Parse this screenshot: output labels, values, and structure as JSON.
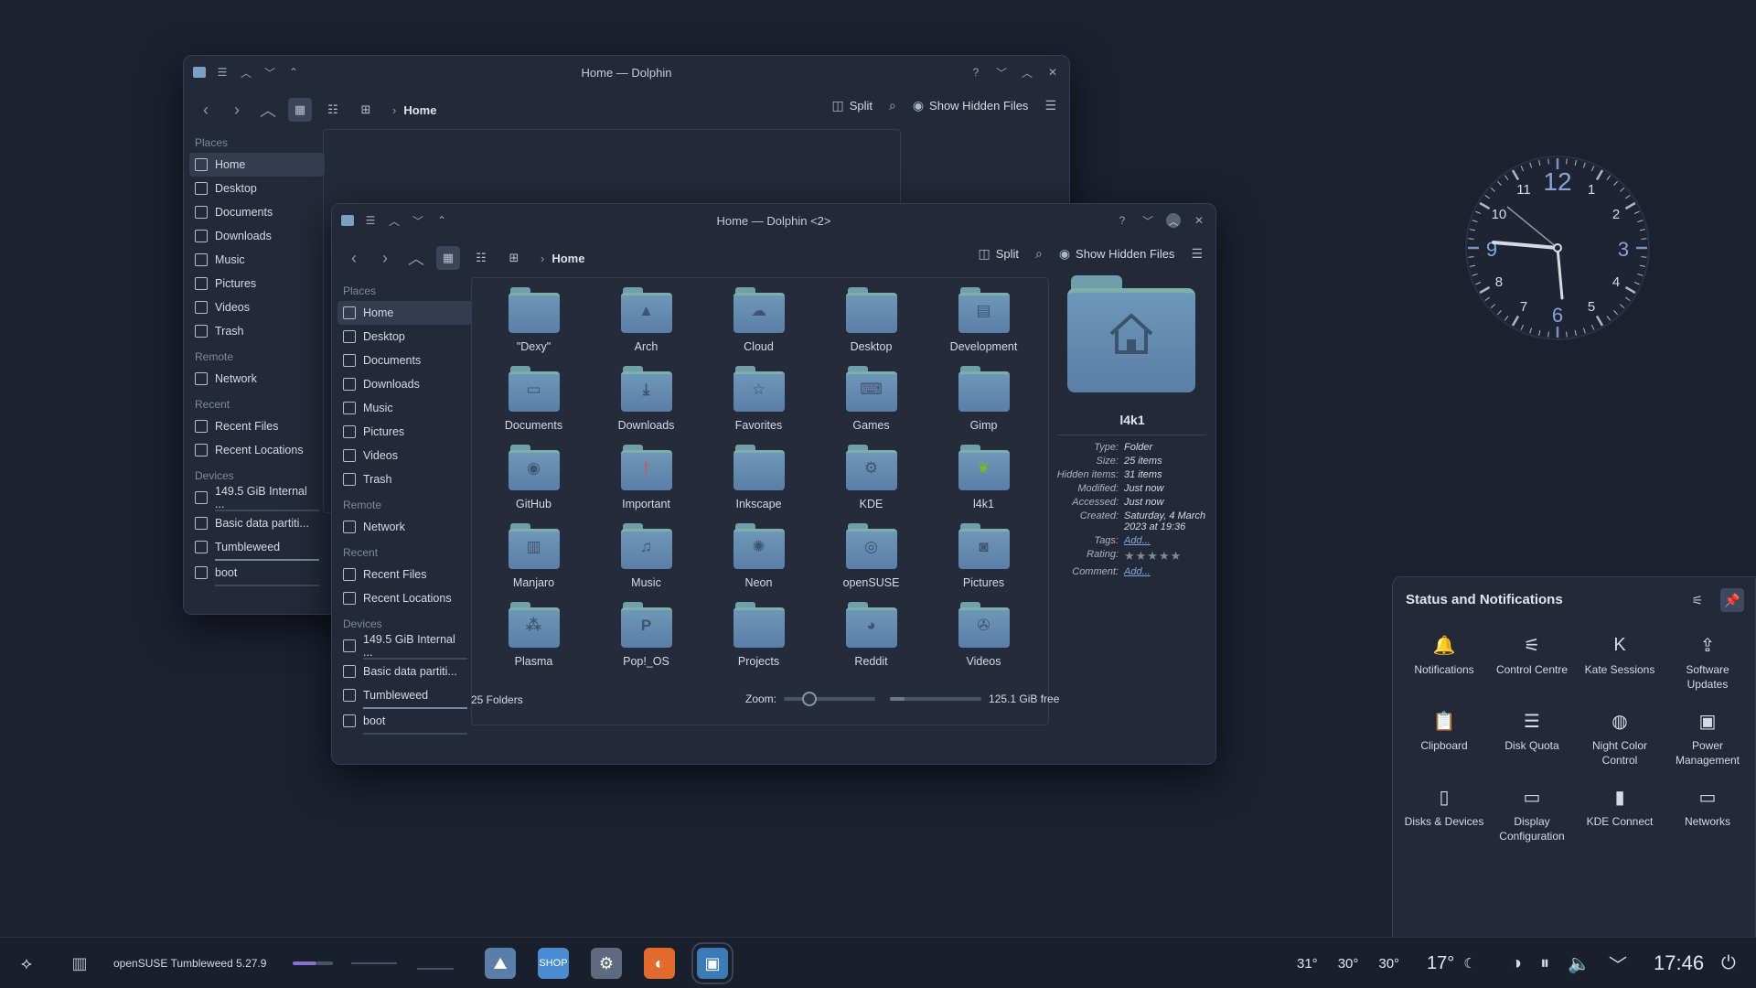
{
  "back_window": {
    "title": "Home — Dolphin",
    "breadcrumb": "Home",
    "toolbar": {
      "split": "Split",
      "show_hidden": "Show Hidden Files"
    },
    "sidebar": {
      "places_heading": "Places",
      "places": [
        "Home",
        "Desktop",
        "Documents",
        "Downloads",
        "Music",
        "Pictures",
        "Videos",
        "Trash"
      ],
      "remote_heading": "Remote",
      "remote": [
        "Network"
      ],
      "recent_heading": "Recent",
      "recent": [
        "Recent Files",
        "Recent Locations"
      ],
      "devices_heading": "Devices",
      "devices": [
        "149.5 GiB Internal ...",
        "Basic data partiti...",
        "Tumbleweed",
        "boot"
      ]
    }
  },
  "front_window": {
    "title": "Home — Dolphin <2>",
    "breadcrumb": "Home",
    "toolbar": {
      "split": "Split",
      "show_hidden": "Show Hidden Files"
    },
    "sidebar": {
      "places_heading": "Places",
      "places": [
        "Home",
        "Desktop",
        "Documents",
        "Downloads",
        "Music",
        "Pictures",
        "Videos",
        "Trash"
      ],
      "remote_heading": "Remote",
      "remote": [
        "Network"
      ],
      "recent_heading": "Recent",
      "recent": [
        "Recent Files",
        "Recent Locations"
      ],
      "devices_heading": "Devices",
      "devices": [
        "149.5 GiB Internal ...",
        "Basic data partiti...",
        "Tumbleweed",
        "boot"
      ]
    },
    "folders": [
      {
        "name": "\"Dexy\"",
        "icon": "blank-folder-icon"
      },
      {
        "name": "Arch",
        "icon": "arch-logo-icon"
      },
      {
        "name": "Cloud",
        "icon": "cloud-icon"
      },
      {
        "name": "Desktop",
        "icon": "desktop-icon"
      },
      {
        "name": "Development",
        "icon": "development-icon"
      },
      {
        "name": "Documents",
        "icon": "document-icon"
      },
      {
        "name": "Downloads",
        "icon": "download-icon"
      },
      {
        "name": "Favorites",
        "icon": "star-icon"
      },
      {
        "name": "Games",
        "icon": "gamepad-icon"
      },
      {
        "name": "Gimp",
        "icon": "blank-folder-icon"
      },
      {
        "name": "GitHub",
        "icon": "github-icon"
      },
      {
        "name": "Important",
        "icon": "exclamation-icon"
      },
      {
        "name": "Inkscape",
        "icon": "blank-folder-icon"
      },
      {
        "name": "KDE",
        "icon": "kde-logo-icon"
      },
      {
        "name": "l4k1",
        "icon": "chameleon-icon"
      },
      {
        "name": "Manjaro",
        "icon": "manjaro-logo-icon"
      },
      {
        "name": "Music",
        "icon": "music-note-icon"
      },
      {
        "name": "Neon",
        "icon": "neon-logo-icon"
      },
      {
        "name": "openSUSE",
        "icon": "opensuse-logo-icon"
      },
      {
        "name": "Pictures",
        "icon": "camera-icon"
      },
      {
        "name": "Plasma",
        "icon": "plasma-logo-icon"
      },
      {
        "name": "Pop!_OS",
        "icon": "popos-logo-icon"
      },
      {
        "name": "Projects",
        "icon": "blank-folder-icon"
      },
      {
        "name": "Reddit",
        "icon": "reddit-icon"
      },
      {
        "name": "Videos",
        "icon": "film-reel-icon"
      }
    ],
    "status": {
      "count": "25 Folders",
      "zoom_label": "Zoom:",
      "free": "125.1 GiB free",
      "zoom_level": 0.2,
      "used_fraction": 0.16
    },
    "info": {
      "name": "l4k1",
      "props": [
        {
          "k": "Type:",
          "v": "Folder"
        },
        {
          "k": "Size:",
          "v": "25 items"
        },
        {
          "k": "Hidden items:",
          "v": "31 items"
        },
        {
          "k": "Modified:",
          "v": "Just now"
        },
        {
          "k": "Accessed:",
          "v": "Just now"
        },
        {
          "k": "Created:",
          "v": "Saturday, 4 March 2023 at 19:36"
        }
      ],
      "tags_label": "Tags:",
      "tags_value": "Add...",
      "rating_label": "Rating:",
      "rating_value": 0,
      "comment_label": "Comment:",
      "comment_value": "Add..."
    }
  },
  "clock": {
    "numerals": [
      "12",
      "1",
      "2",
      "3",
      "4",
      "5",
      "6",
      "7",
      "8",
      "9",
      "10",
      "11"
    ],
    "time": "17:46"
  },
  "notifications_panel": {
    "title": "Status and Notifications",
    "items": [
      {
        "label": "Notifications",
        "icon": "bell-icon"
      },
      {
        "label": "Control Centre",
        "icon": "sliders-icon"
      },
      {
        "label": "Kate Sessions",
        "icon": "kate-icon"
      },
      {
        "label": "Software Updates",
        "icon": "update-icon"
      },
      {
        "label": "Clipboard",
        "icon": "clipboard-icon"
      },
      {
        "label": "Disk Quota",
        "icon": "disk-quota-icon"
      },
      {
        "label": "Night Color Control",
        "icon": "night-color-icon"
      },
      {
        "label": "Power Management",
        "icon": "power-management-icon"
      },
      {
        "label": "Disks & Devices",
        "icon": "disks-icon"
      },
      {
        "label": "Display Configuration",
        "icon": "display-icon"
      },
      {
        "label": "KDE Connect",
        "icon": "kde-connect-icon"
      },
      {
        "label": "Networks",
        "icon": "network-icon"
      }
    ]
  },
  "taskbar": {
    "window_title": "openSUSE Tumbleweed 5.27.9",
    "temps": [
      "31°",
      "30°",
      "30°"
    ],
    "weather": "17°",
    "time": "17:46",
    "accent": "#8e6fd8"
  }
}
